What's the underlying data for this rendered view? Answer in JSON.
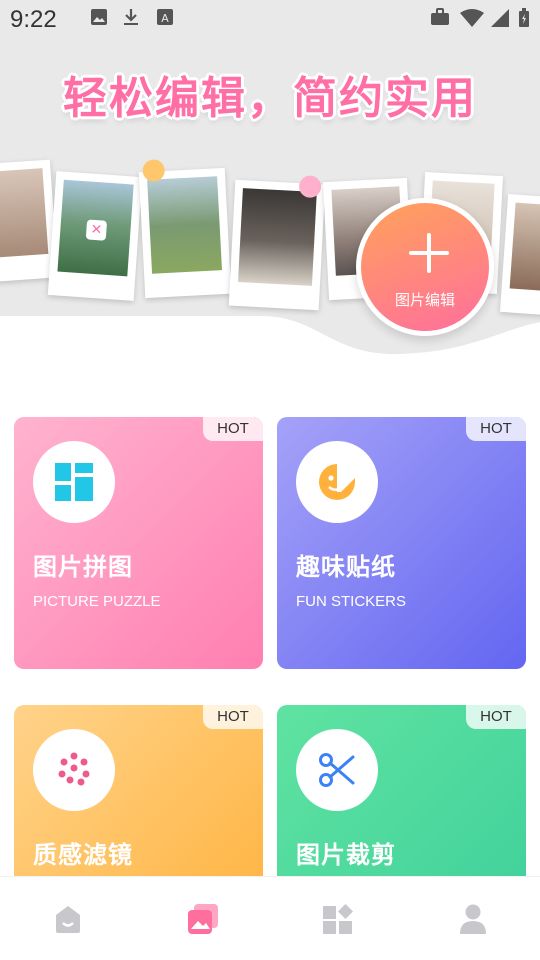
{
  "status_bar": {
    "time": "9:22"
  },
  "banner": {
    "slogan": "轻松编辑，简约实用",
    "edit_button_label": "图片编辑"
  },
  "features": [
    {
      "title": "图片拼图",
      "subtitle": "PICTURE PUZZLE",
      "badge": "HOT",
      "icon": "grid-icon"
    },
    {
      "title": "趣味贴纸",
      "subtitle": "FUN STICKERS",
      "badge": "HOT",
      "icon": "sticker-icon"
    },
    {
      "title": "质感滤镜",
      "subtitle": "",
      "badge": "HOT",
      "icon": "filter-dots-icon"
    },
    {
      "title": "图片裁剪",
      "subtitle": "",
      "badge": "HOT",
      "icon": "scissors-icon"
    }
  ],
  "bottom_nav": {
    "items": [
      "home-icon",
      "gallery-icon",
      "apps-icon",
      "profile-icon"
    ],
    "active": "gallery-icon"
  },
  "colors": {
    "brand_pink": "#ff6fa6",
    "card1": "#ff7fb0",
    "card2": "#7c7cf6",
    "card3": "#ffb54a",
    "card4": "#4fd6a0"
  }
}
